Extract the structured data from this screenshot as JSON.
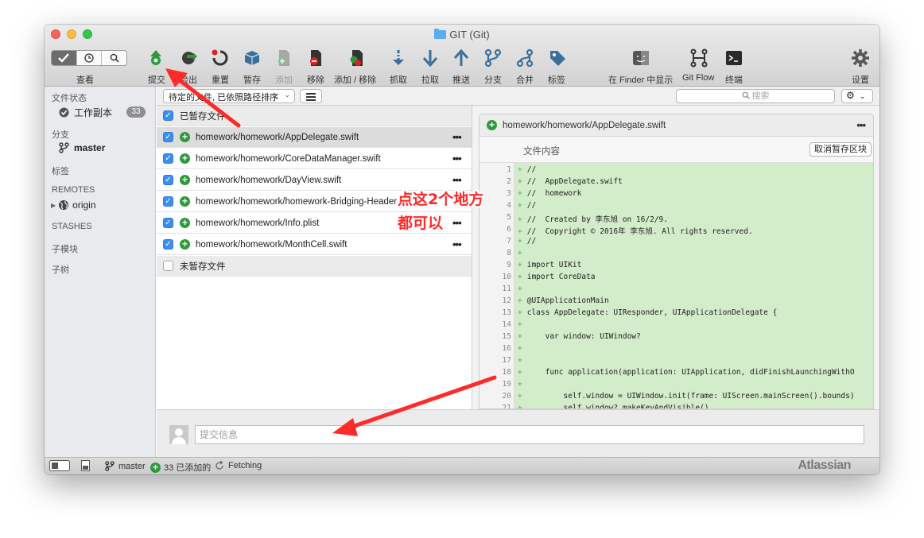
{
  "window": {
    "title": "GIT (Git)"
  },
  "toolbar": {
    "view_label": "查看",
    "items": [
      {
        "label": "提交",
        "disabled": false
      },
      {
        "label": "检出",
        "disabled": false
      },
      {
        "label": "重置",
        "disabled": false
      },
      {
        "label": "暂存",
        "disabled": false
      },
      {
        "label": "添加",
        "disabled": true
      },
      {
        "label": "移除",
        "disabled": false
      },
      {
        "label": "添加 / 移除",
        "disabled": false
      },
      {
        "label": "抓取",
        "disabled": false
      },
      {
        "label": "拉取",
        "disabled": false
      },
      {
        "label": "推送",
        "disabled": false
      },
      {
        "label": "分支",
        "disabled": false
      },
      {
        "label": "合并",
        "disabled": false
      },
      {
        "label": "标签",
        "disabled": false
      },
      {
        "label": "在 Finder 中显示",
        "disabled": false
      },
      {
        "label": "Git Flow",
        "disabled": false
      },
      {
        "label": "终端",
        "disabled": false
      },
      {
        "label": "设置",
        "disabled": false
      }
    ]
  },
  "sidebar": {
    "file_status": "文件状态",
    "working_copy": "工作副本",
    "working_copy_count": "33",
    "branches": "分支",
    "branch_master": "master",
    "tags": "标签",
    "remotes": "REMOTES",
    "remote_origin": "origin",
    "stashes": "STASHES",
    "submodules": "子模块",
    "subtrees": "子树"
  },
  "filter": {
    "select_value": "待定的文件, 已依照路径排序",
    "search_placeholder": "搜索"
  },
  "staged": {
    "header": "已暂存文件",
    "files": [
      "homework/homework/AppDelegate.swift",
      "homework/homework/CoreDataManager.swift",
      "homework/homework/DayView.swift",
      "homework/homework/homework-Bridging-Header.h",
      "homework/homework/Info.plist",
      "homework/homework/MonthCell.swift"
    ]
  },
  "unstaged": {
    "header": "未暂存文件"
  },
  "diff": {
    "file": "homework/homework/AppDelegate.swift",
    "hunk_title": "文件内容",
    "unstage_label": "取消暂存区块",
    "lines": [
      {
        "n": "1",
        "t": "//"
      },
      {
        "n": "2",
        "t": "//  AppDelegate.swift"
      },
      {
        "n": "3",
        "t": "//  homework"
      },
      {
        "n": "4",
        "t": "//"
      },
      {
        "n": "5",
        "t": "//  Created by 李东旭 on 16/2/9."
      },
      {
        "n": "6",
        "t": "//  Copyright © 2016年 李东旭. All rights reserved."
      },
      {
        "n": "7",
        "t": "//"
      },
      {
        "n": "8",
        "t": ""
      },
      {
        "n": "9",
        "t": "import UIKit"
      },
      {
        "n": "10",
        "t": "import CoreData"
      },
      {
        "n": "11",
        "t": ""
      },
      {
        "n": "12",
        "t": "@UIApplicationMain"
      },
      {
        "n": "13",
        "t": "class AppDelegate: UIResponder, UIApplicationDelegate {"
      },
      {
        "n": "14",
        "t": ""
      },
      {
        "n": "15",
        "t": "    var window: UIWindow?"
      },
      {
        "n": "16",
        "t": ""
      },
      {
        "n": "17",
        "t": ""
      },
      {
        "n": "18",
        "t": "    func application(application: UIApplication, didFinishLaunchingWithO"
      },
      {
        "n": "19",
        "t": ""
      },
      {
        "n": "20",
        "t": "        self.window = UIWindow.init(frame: UIScreen.mainScreen().bounds)"
      },
      {
        "n": "21",
        "t": "        self.window?.makeKeyAndVisible()"
      }
    ]
  },
  "commit": {
    "placeholder": "提交信息"
  },
  "statusbar": {
    "branch": "master",
    "added": "33 已添加的",
    "fetching": "Fetching",
    "brand": "Atlassian"
  },
  "annotation": {
    "line1": "点这2个地方",
    "line2": "都可以"
  },
  "colors": {
    "accent": "#3b8ff2",
    "added": "#2e9a3a",
    "diff_bg": "#d3ecc9",
    "annotation": "#ff2a2a"
  }
}
